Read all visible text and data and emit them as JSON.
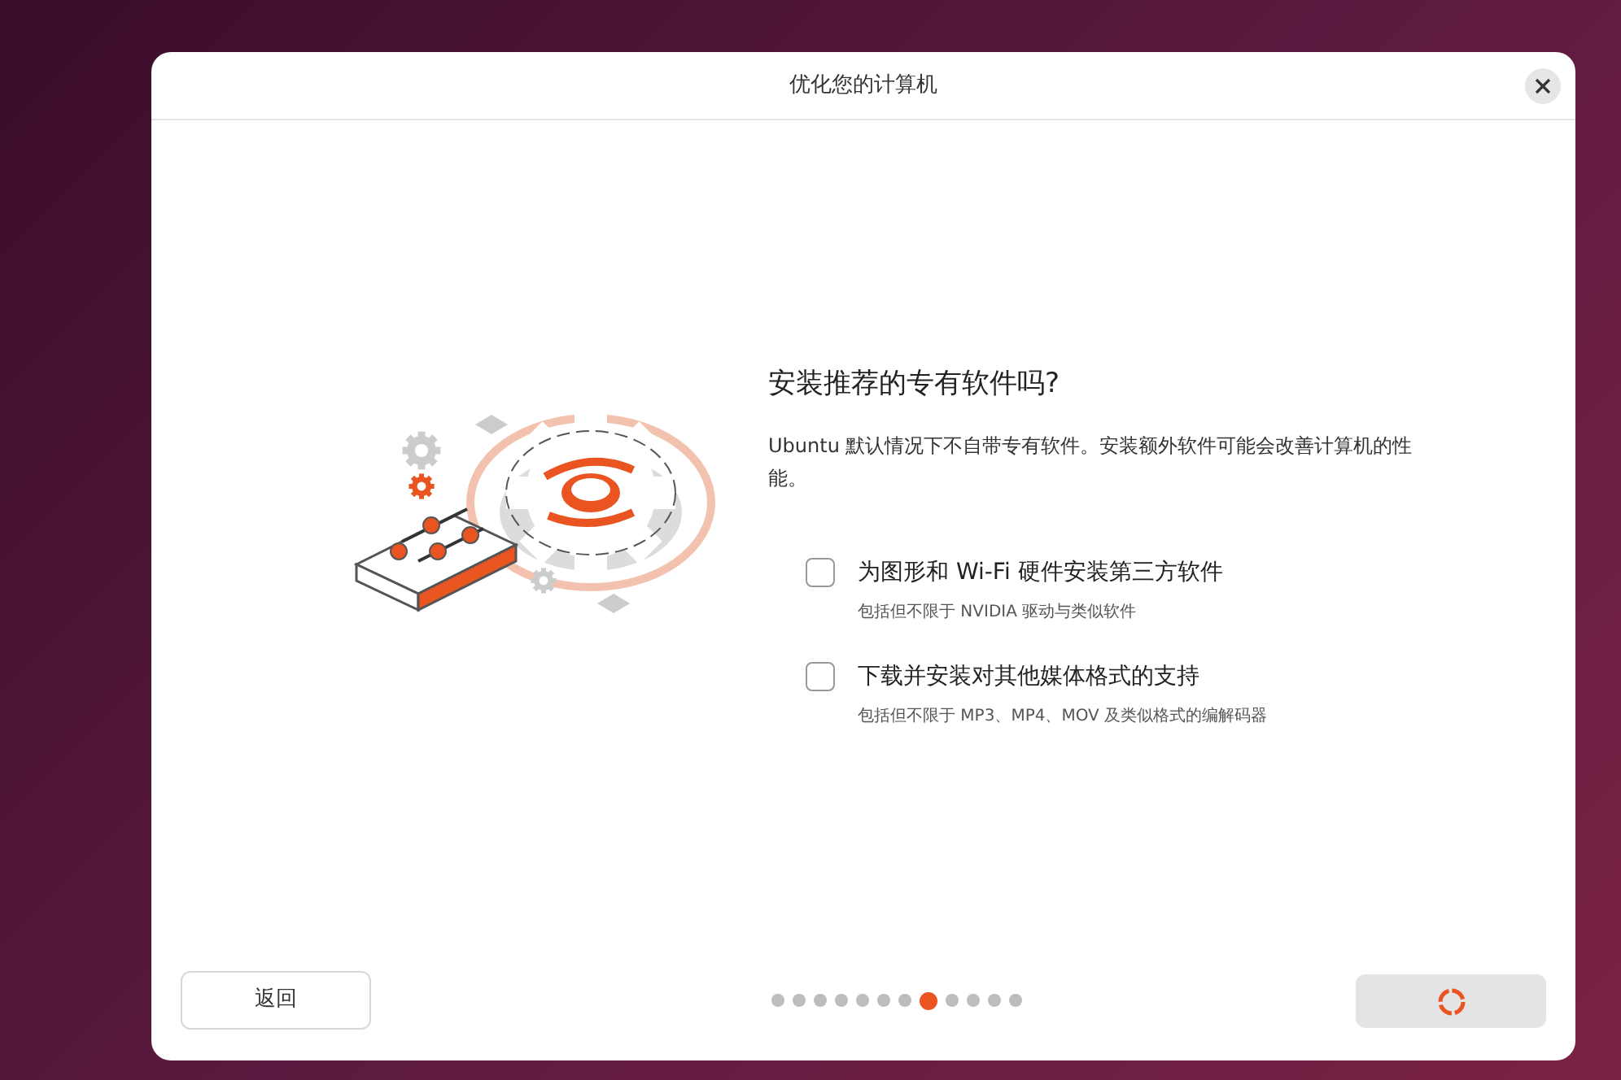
{
  "window": {
    "title": "优化您的计算机"
  },
  "heading": "安装推荐的专有软件吗?",
  "description": "Ubuntu 默认情况下不自带专有软件。安装额外软件可能会改善计算机的性能。",
  "options": [
    {
      "label": "为图形和 Wi-Fi 硬件安装第三方软件",
      "hint": "包括但不限于 NVIDIA 驱动与类似软件",
      "checked": false
    },
    {
      "label": "下载并安装对其他媒体格式的支持",
      "hint": "包括但不限于 MP3、MP4、MOV 及类似格式的编解码器",
      "checked": false
    }
  ],
  "back_button": "返回",
  "next_button": {
    "disabled": true
  },
  "steps": [
    {
      "selected": false
    },
    {
      "selected": false
    },
    {
      "selected": false
    },
    {
      "selected": false
    },
    {
      "selected": false
    },
    {
      "selected": false
    },
    {
      "selected": false
    },
    {
      "selected": true
    },
    {
      "selected": false
    },
    {
      "selected": false
    },
    {
      "selected": false
    },
    {
      "selected": false
    }
  ]
}
